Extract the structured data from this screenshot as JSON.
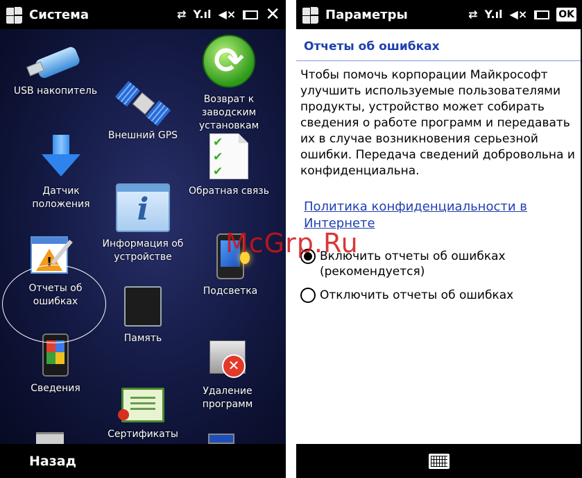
{
  "left": {
    "title": "Система",
    "back_label": "Назад",
    "apps": {
      "usb": "USB накопитель",
      "reset": "Возврат к заводским установкам",
      "gps": "Внешний GPS",
      "sensor": "Датчик положения",
      "feedback": "Обратная связь",
      "device_info": "Информация об устройстве",
      "error_reports": "Отчеты об ошибках",
      "backlight": "Подсветка",
      "memory": "Память",
      "about": "Сведения",
      "remove": "Удаление программ",
      "certificates": "Сертификаты"
    }
  },
  "right": {
    "title": "Параметры",
    "section_title": "Отчеты об ошибках",
    "description": "Чтобы помочь корпорации Майкрософт улучшить используемые пользователями продукты, устройство может собирать сведения о работе программ и передавать их в случае возникновения серьезной ошибки. Передача сведений добровольна и конфиденциальна.",
    "policy_link": "Политика конфиденциальности в Интернете",
    "options": [
      {
        "label": "Включить отчеты об ошибках (рекомендуется)",
        "selected": true
      },
      {
        "label": "Отключить отчеты об ошибках",
        "selected": false
      }
    ],
    "ok_label": "OK"
  },
  "watermark": "McGrp.Ru",
  "colors": {
    "accent": "#1f3fb0",
    "title_bar": "#000000"
  }
}
